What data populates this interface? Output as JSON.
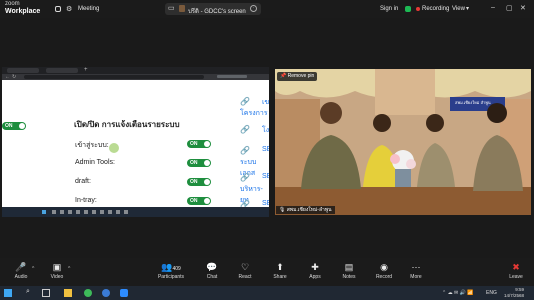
{
  "top": {
    "brand_line1": "zoom",
    "brand_line2": "Workplace",
    "meeting_label": "Meeting",
    "share_title": "ปรีดิ - GDCC's screen",
    "signin": "Sign in",
    "recording": "Recording",
    "view": "View"
  },
  "share": {
    "heading": "เปิด/ปิด การแจ้งเตือนรายระบบ",
    "on_label": "ON",
    "settings": [
      {
        "label": "เข้าสู่ระบบ:"
      },
      {
        "label": "Admin Tools:"
      },
      {
        "label": "draft:"
      },
      {
        "label": "In-tray:"
      }
    ],
    "links": [
      "เข",
      "โครงการ",
      "โง",
      "SE",
      "ระบบเอกส",
      "SE",
      "บริหาร-ยุท",
      "SE"
    ]
  },
  "video": {
    "remove_pin": "Remove pin",
    "name": "สพม.เชียงใหม่-ลำพูน",
    "banner": "สพม.เชียงใหม่ ลำพูน"
  },
  "toolbar": {
    "participants_count": "409",
    "items": [
      {
        "label": "Audio"
      },
      {
        "label": "Video"
      },
      {
        "label": "Participants"
      },
      {
        "label": "Chat"
      },
      {
        "label": "React"
      },
      {
        "label": "Share"
      },
      {
        "label": "Apps"
      },
      {
        "label": "Notes"
      },
      {
        "label": "Record"
      },
      {
        "label": "More"
      },
      {
        "label": "Leave"
      }
    ]
  },
  "taskbar": {
    "time": "9:59",
    "date": "14/7/2568",
    "lang": "ENG"
  },
  "colors": {
    "accent_green": "#1e8e3e",
    "recording_red": "#e53935",
    "leave_red": "#e53935"
  }
}
